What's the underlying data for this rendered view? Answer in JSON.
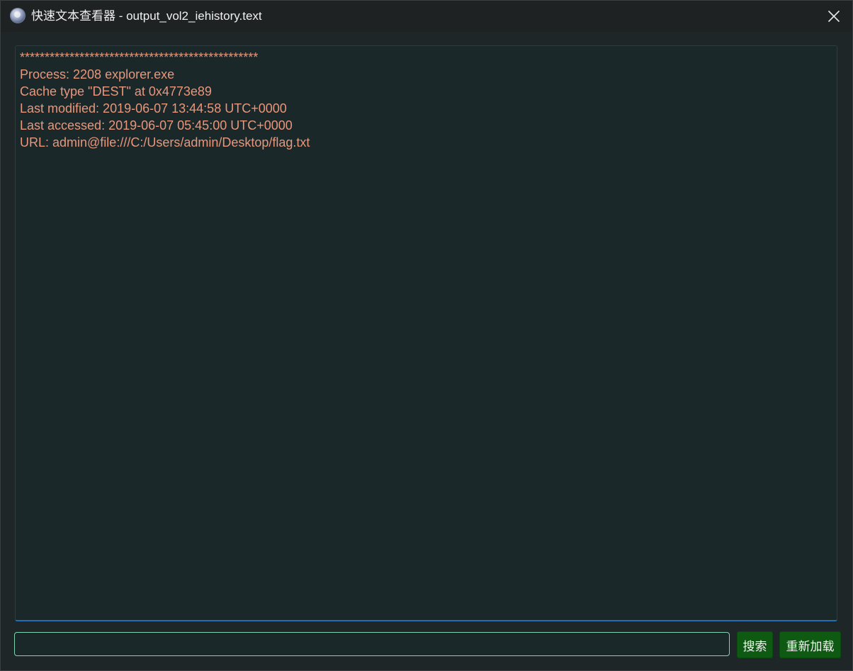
{
  "window": {
    "title": "快速文本查看器 - output_vol2_iehistory.text",
    "app_icon": "app-globe-icon",
    "close_icon": "close-icon"
  },
  "content": {
    "lines": [
      "************************************************",
      "Process: 2208 explorer.exe",
      "Cache type \"DEST\" at 0x4773e89",
      "Last modified: 2019-06-07 13:44:58 UTC+0000",
      "Last accessed: 2019-06-07 05:45:00 UTC+0000",
      "URL: admin@file:///C:/Users/admin/Desktop/flag.txt"
    ]
  },
  "search": {
    "value": "",
    "placeholder": ""
  },
  "buttons": {
    "search_label": "搜索",
    "reload_label": "重新加载"
  },
  "colors": {
    "text": "#e9967a",
    "background": "#1b282a",
    "button_bg": "#0e5a12",
    "input_border": "#7fd4b0",
    "focus_underline": "#1f6fb8"
  }
}
